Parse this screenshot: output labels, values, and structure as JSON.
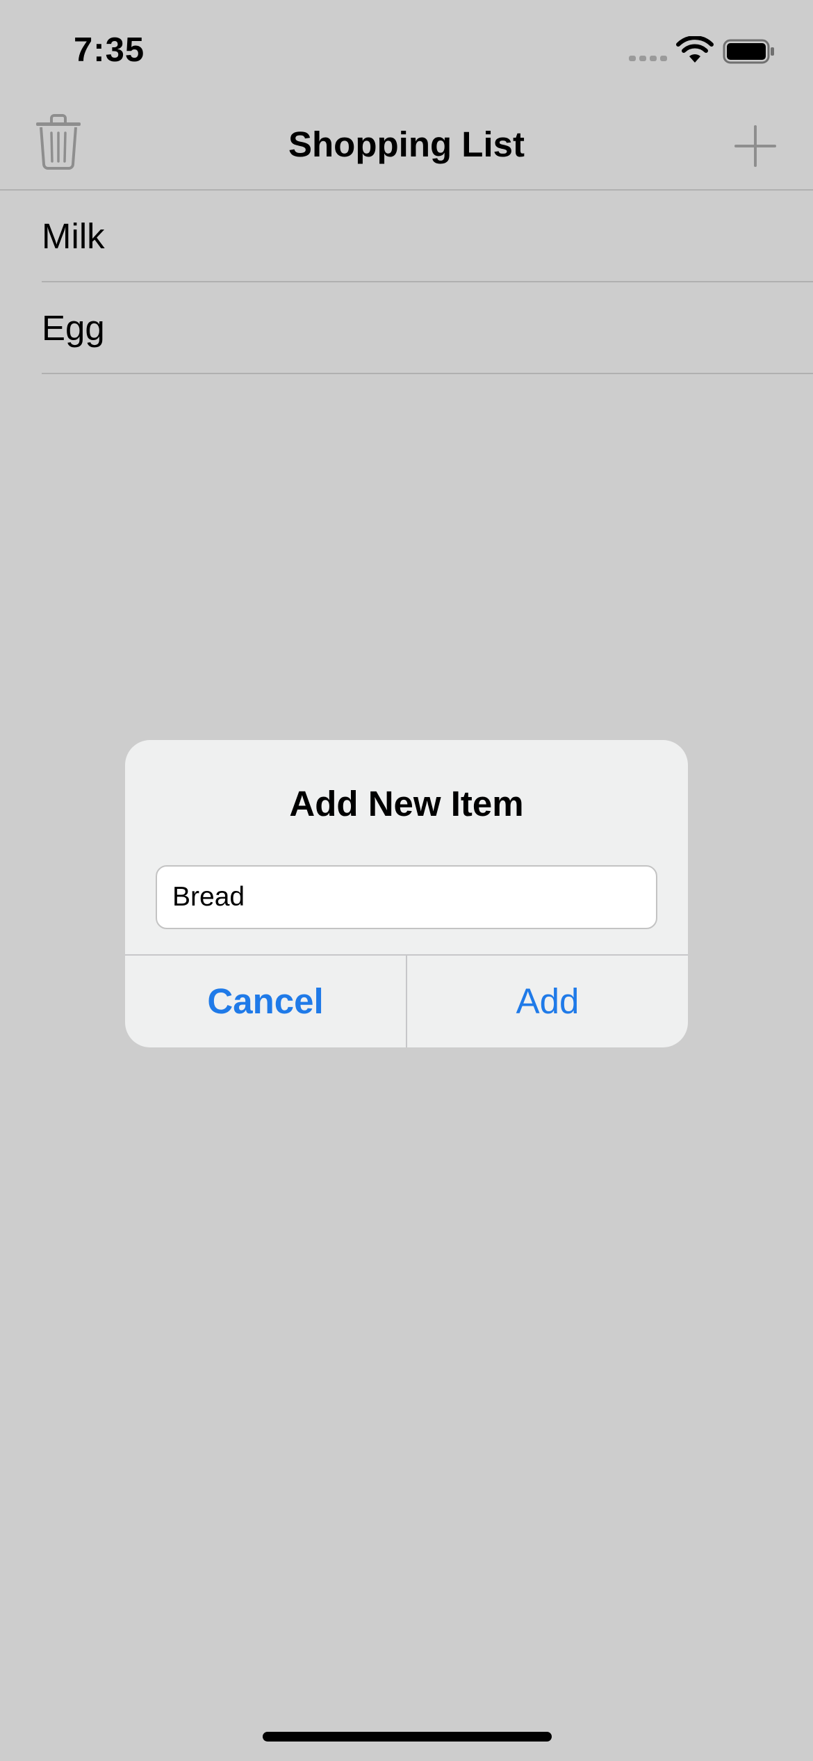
{
  "status_bar": {
    "time": "7:35",
    "icons": [
      "cellular-signal-icon",
      "wifi-icon",
      "battery-icon"
    ]
  },
  "nav": {
    "title": "Shopping List",
    "left_icon": "trash-icon",
    "right_icon": "plus-icon"
  },
  "list": {
    "items": [
      {
        "label": "Milk"
      },
      {
        "label": "Egg"
      }
    ]
  },
  "alert": {
    "title": "Add New Item",
    "input_value": "Bread",
    "cancel_label": "Cancel",
    "confirm_label": "Add"
  },
  "colors": {
    "background": "#cdcdcd",
    "alert_background": "#eff0f0",
    "accent": "#1f7ae8",
    "icon_gray": "#8e8e8e"
  }
}
